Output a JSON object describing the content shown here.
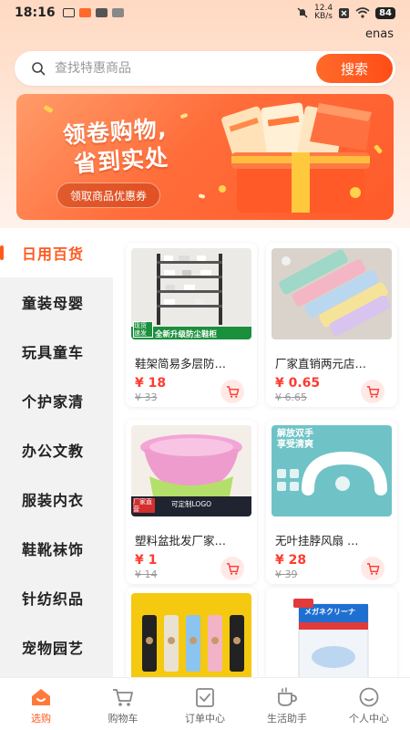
{
  "status_bar": {
    "time": "18:16",
    "network_speed": "12.4\nKB/s",
    "battery": "84"
  },
  "app": {
    "name": "enas"
  },
  "search": {
    "placeholder": "查找特惠商品",
    "button_label": "搜索"
  },
  "banner": {
    "title_line1": "领卷购物,",
    "title_line2": "省到实处",
    "button_label": "领取商品优惠券"
  },
  "sidebar": {
    "items": [
      {
        "label": "日用百货",
        "active": true
      },
      {
        "label": "童装母婴"
      },
      {
        "label": "玩具童车"
      },
      {
        "label": "个护家清"
      },
      {
        "label": "办公文教"
      },
      {
        "label": "服装内衣"
      },
      {
        "label": "鞋靴袜饰"
      },
      {
        "label": "针纺织品"
      },
      {
        "label": "宠物园艺"
      }
    ]
  },
  "products": [
    {
      "title": "鞋架简易多层防…",
      "price": "¥ 18",
      "original_price": "¥ 33",
      "thumb_text": "全新升级防尘鞋柜",
      "thumb_tag": "现货速发"
    },
    {
      "title": "厂家直销两元店…",
      "price": "¥ 0.65",
      "original_price": "¥ 6.65"
    },
    {
      "title": "塑料盆批发厂家…",
      "price": "¥ 1",
      "original_price": "¥ 14",
      "thumb_text": "可定制LOGO",
      "thumb_tag": "厂家直营"
    },
    {
      "title": "无叶挂脖风扇 …",
      "price": "¥ 28",
      "original_price": "¥ 39",
      "thumb_text": "解放双手\n享受清爽"
    },
    {
      "title": "",
      "price": "",
      "original_price": ""
    },
    {
      "title": "",
      "price": "",
      "original_price": "",
      "thumb_text": "メガネクリーナ"
    }
  ],
  "tabbar": {
    "items": [
      {
        "label": "选购",
        "icon": "home-icon",
        "active": true
      },
      {
        "label": "购物车",
        "icon": "cart-icon"
      },
      {
        "label": "订单中心",
        "icon": "order-icon"
      },
      {
        "label": "生活助手",
        "icon": "cup-icon"
      },
      {
        "label": "个人中心",
        "icon": "profile-icon"
      }
    ]
  },
  "colors": {
    "accent": "#ff5a1e",
    "price": "#ff3b30"
  }
}
